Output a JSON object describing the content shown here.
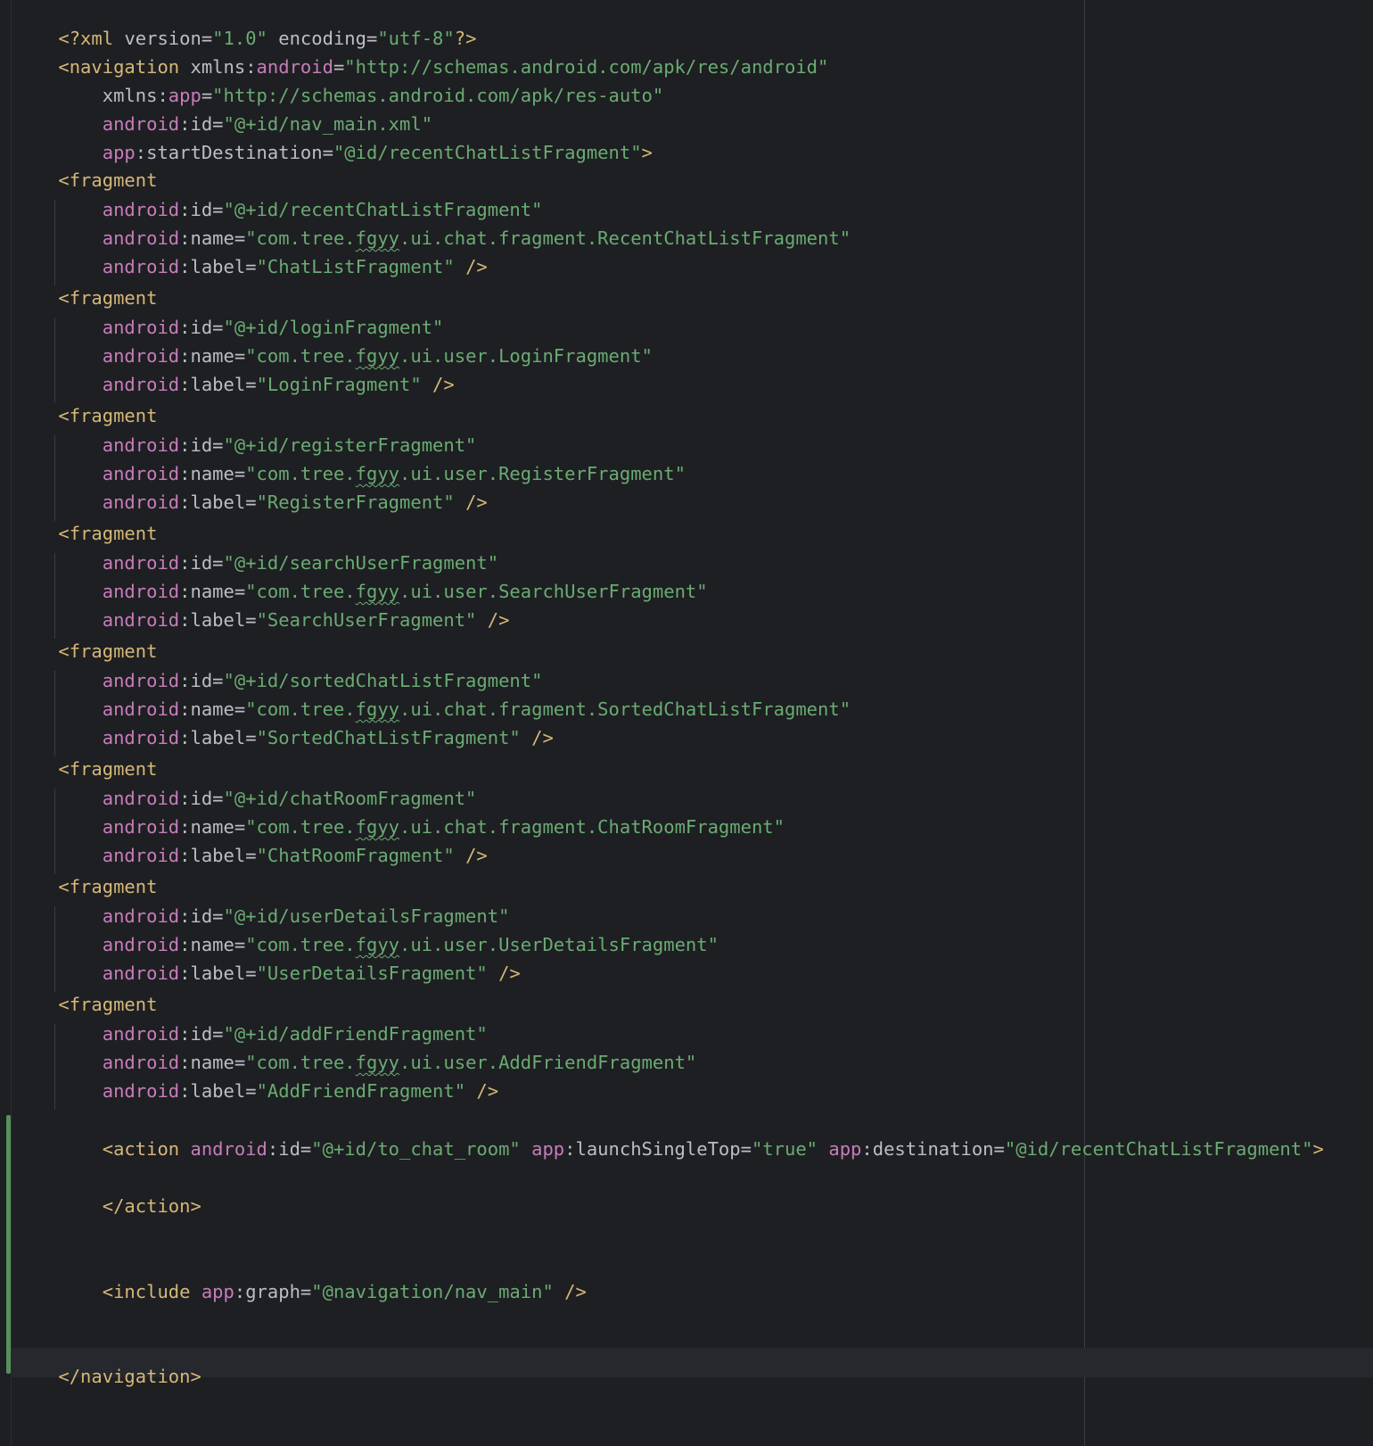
{
  "colors": {
    "background": "#1e1f22",
    "tag": "#d5b778",
    "namespace": "#c77dbb",
    "attribute": "#bcbec4",
    "string": "#6aab73",
    "change_marker": "#549159"
  },
  "xml_decl": {
    "open": "<?xml ",
    "version_attr": "version",
    "version_eq": "=",
    "version_val": "\"1.0\"",
    "encoding_attr": " encoding",
    "encoding_eq": "=",
    "encoding_val": "\"utf-8\"",
    "close": "?>"
  },
  "navigation": {
    "open": "<navigation",
    "xmlns_prefix": " xmlns:",
    "xmlns_android_name": "android",
    "xmlns_android_eq": "=",
    "xmlns_android_val": "\"http://schemas.android.com/apk/res/android\"",
    "xmlns_app_indent": "    xmlns:",
    "xmlns_app_name": "app",
    "xmlns_app_eq": "=",
    "xmlns_app_val": "\"http://schemas.android.com/apk/res-auto\"",
    "id_indent": "    ",
    "id_ns": "android",
    "id_attr": ":id=",
    "id_val": "\"@+id/nav_main.xml\"",
    "start_indent": "    ",
    "start_ns": "app",
    "start_attr": ":startDestination=",
    "start_val": "\"@id/recentChatListFragment\"",
    "start_close": ">",
    "close": "</navigation>"
  },
  "fragment_tag": "    <fragment",
  "attr_indent": "        ",
  "android_ns": "android",
  "id_attr": ":id=",
  "name_attr": ":name=",
  "label_attr": ":label=",
  "self_close": " />",
  "fragments": [
    {
      "id": "\"@+id/recentChatListFragment\"",
      "name_pre": "\"com.tree.",
      "name_pkg": "fgyy",
      "name_post": ".ui.chat.fragment.RecentChatListFragment\"",
      "label": "\"ChatListFragment\""
    },
    {
      "id": "\"@+id/loginFragment\"",
      "name_pre": "\"com.tree.",
      "name_pkg": "fgyy",
      "name_post": ".ui.user.LoginFragment\"",
      "label": "\"LoginFragment\""
    },
    {
      "id": "\"@+id/registerFragment\"",
      "name_pre": "\"com.tree.",
      "name_pkg": "fgyy",
      "name_post": ".ui.user.RegisterFragment\"",
      "label": "\"RegisterFragment\""
    },
    {
      "id": "\"@+id/searchUserFragment\"",
      "name_pre": "\"com.tree.",
      "name_pkg": "fgyy",
      "name_post": ".ui.user.SearchUserFragment\"",
      "label": "\"SearchUserFragment\""
    },
    {
      "id": "\"@+id/sortedChatListFragment\"",
      "name_pre": "\"com.tree.",
      "name_pkg": "fgyy",
      "name_post": ".ui.chat.fragment.SortedChatListFragment\"",
      "label": "\"SortedChatListFragment\""
    },
    {
      "id": "\"@+id/chatRoomFragment\"",
      "name_pre": "\"com.tree.",
      "name_pkg": "fgyy",
      "name_post": ".ui.chat.fragment.ChatRoomFragment\"",
      "label": "\"ChatRoomFragment\""
    },
    {
      "id": "\"@+id/userDetailsFragment\"",
      "name_pre": "\"com.tree.",
      "name_pkg": "fgyy",
      "name_post": ".ui.user.UserDetailsFragment\"",
      "label": "\"UserDetailsFragment\""
    },
    {
      "id": "\"@+id/addFriendFragment\"",
      "name_pre": "\"com.tree.",
      "name_pkg": "fgyy",
      "name_post": ".ui.user.AddFriendFragment\"",
      "label": "\"AddFriendFragment\""
    }
  ],
  "action": {
    "open": "    <action",
    "id_ns": " android",
    "id_attr": ":id=",
    "id_val": "\"@+id/to_chat_room\"",
    "single_ns": " app",
    "single_attr": ":launchSingleTop=",
    "single_val": "\"true\"",
    "dest_ns": " app",
    "dest_attr": ":destination=",
    "dest_val": "\"@id/recentChatListFragment\"",
    "open_close": ">",
    "close": "    </action>"
  },
  "include": {
    "open": "    <include",
    "graph_ns": " app",
    "graph_attr": ":graph=",
    "graph_val": "\"@navigation/nav_main\"",
    "close": " />"
  }
}
